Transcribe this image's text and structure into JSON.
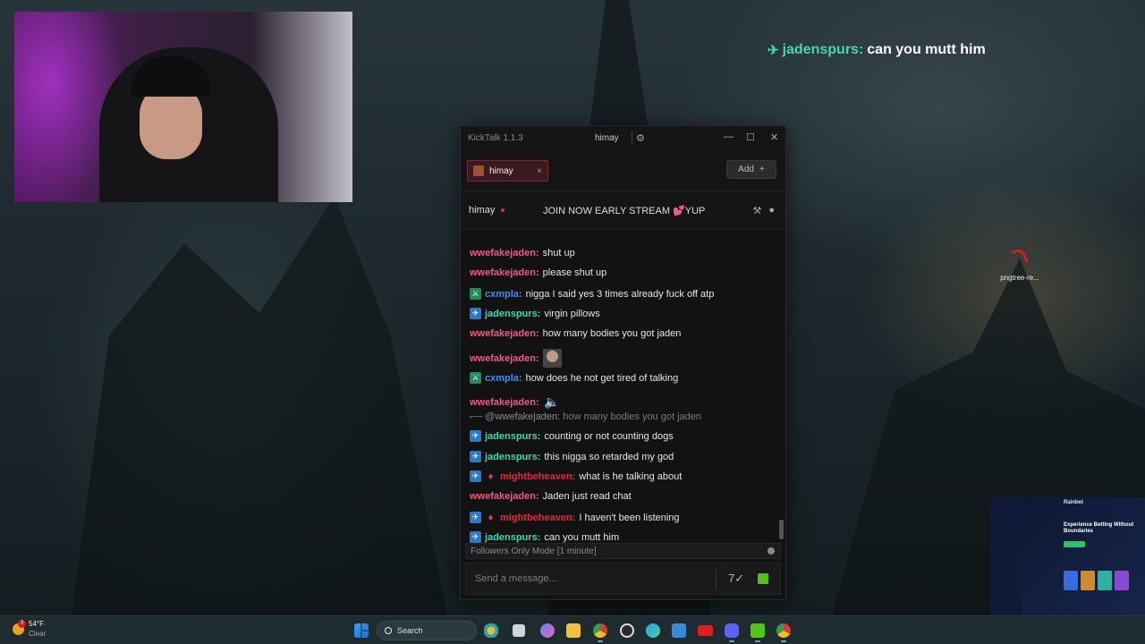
{
  "overlay": {
    "username": "jadenspurs:",
    "text": "can you mutt him"
  },
  "desktop_icon": {
    "label": "pngtree-re..."
  },
  "promo": {
    "brand": "Rainbet",
    "headline": "Experience Betting Without Boundaries"
  },
  "window": {
    "app_name": "KickTalk 1.1.3",
    "user": "himay",
    "gear_icon": "gear-icon",
    "controls": [
      "—",
      "☐",
      "✕"
    ]
  },
  "tabs": [
    {
      "label": "himay",
      "close": "×"
    }
  ],
  "add_button": {
    "label": "Add",
    "icon": "+"
  },
  "channel": {
    "name": "himay",
    "title": "JOIN NOW EARLY STREAM",
    "title_emote": "💕",
    "title_suffix": "YUP"
  },
  "messages": [
    {
      "user": "wwefakejaden:",
      "color": "#ef5a85",
      "text": "shut up",
      "badges": []
    },
    {
      "user": "wwefakejaden:",
      "color": "#ef5a85",
      "text": "please shut up",
      "badges": []
    },
    {
      "user": "cxmpla:",
      "color": "#3a8ff0",
      "text": "nigga I said yes 3 times already fuck off atp",
      "badges": [
        "sword"
      ]
    },
    {
      "user": "jadenspurs:",
      "color": "#3fd7b5",
      "text": "virgin pillows",
      "badges": [
        "sub"
      ]
    },
    {
      "user": "wwefakejaden:",
      "color": "#ef5a85",
      "text": "how many bodies you got jaden",
      "badges": []
    },
    {
      "user": "wwefakejaden:",
      "color": "#ef5a85",
      "text": "",
      "badges": [],
      "emote": "face"
    },
    {
      "user": "cxmpla:",
      "color": "#3a8ff0",
      "text": "how does he not get tired of talking",
      "badges": [
        "sword"
      ]
    },
    {
      "user": "wwefakejaden:",
      "color": "#ef5a85",
      "text": "",
      "badges": [],
      "emote": "mega"
    },
    {
      "user": "jadenspurs:",
      "color": "#3fd7b5",
      "text": "counting or not counting dogs",
      "badges": [
        "sub"
      ]
    },
    {
      "user": "jadenspurs:",
      "color": "#3fd7b5",
      "text": "this nigga so retarded my god",
      "badges": [
        "sub"
      ]
    },
    {
      "user": "mightbeheaven:",
      "color": "#e2283a",
      "text": "what is he talking about",
      "badges": [
        "sub",
        "flame"
      ]
    },
    {
      "user": "wwefakejaden:",
      "color": "#ef5a85",
      "text": "Jaden just read chat",
      "badges": []
    },
    {
      "user": "mightbeheaven:",
      "color": "#e2283a",
      "text": "I haven't been listening",
      "badges": [
        "sub",
        "flame"
      ]
    },
    {
      "user": "jadenspurs:",
      "color": "#3fd7b5",
      "text": "can you mutt him",
      "badges": [
        "sub"
      ]
    }
  ],
  "reply": {
    "mention": "@wwefakejaden:",
    "text": "how many bodies you got jaden"
  },
  "followers_mode": "Followers Only Mode [1 minute]",
  "input": {
    "placeholder": "Send a message..."
  },
  "taskbar": {
    "temp": "54°F",
    "condition": "Clear",
    "notif_count": "3",
    "search_label": "Search"
  }
}
